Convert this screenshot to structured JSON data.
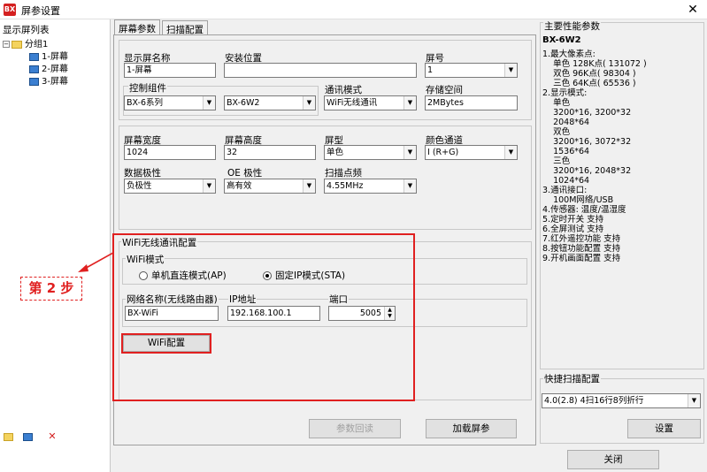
{
  "window": {
    "title": "屏参设置",
    "app_icon": "app-logo-icon",
    "close_glyph": "✕"
  },
  "sidebar": {
    "header": "显示屏列表",
    "group": "分组1",
    "items": [
      "1-屏幕",
      "2-屏幕",
      "3-屏幕"
    ]
  },
  "tabs": [
    "屏幕参数",
    "扫描配置"
  ],
  "screen": {
    "name_label": "显示屏名称",
    "name_value": "1-屏幕",
    "location_label": "安装位置",
    "location_value": "",
    "number_label": "屏号",
    "number_value": "1",
    "control_label": "控制组件",
    "series_value": "BX-6系列",
    "model_value": "BX-6W2",
    "comm_label": "通讯模式",
    "comm_value": "WiFi无线通讯",
    "storage_label": "存储空间",
    "storage_value": "2MBytes",
    "width_label": "屏幕宽度",
    "width_value": "1024",
    "height_label": "屏幕高度",
    "height_value": "32",
    "type_label": "屏型",
    "type_value": "单色",
    "color_label": "颜色通道",
    "color_value": "I (R+G)",
    "data_pol_label": "数据极性",
    "data_pol_value": "负极性",
    "oe_label": "OE 极性",
    "oe_value": "高有效",
    "scan_freq_label": "扫描点频",
    "scan_freq_value": "4.55MHz"
  },
  "wifi": {
    "section_label": "WiFi无线通讯配置",
    "mode_label": "WiFi模式",
    "mode_ap": "单机直连模式(AP)",
    "mode_sta": "固定IP模式(STA)",
    "selected_mode": "sta",
    "ssid_label": "网络名称(无线路由器)",
    "ssid_value": "BX-WiFi",
    "ip_label": "IP地址",
    "ip_value": "192.168.100.1",
    "port_label": "端口",
    "port_value": "5005",
    "config_button": "WiFi配置"
  },
  "buttons": {
    "readback": "参数回读",
    "load": "加载屏参",
    "settings": "设置",
    "close": "关闭"
  },
  "annotation": {
    "step": "第 2 步",
    "color": "#e02020"
  },
  "performance": {
    "title": "主要性能参数",
    "model": "BX-6W2",
    "text": "1.最大像素点:\n    单色 128K点( 131072 )\n    双色 96K点( 98304 )\n    三色 64K点( 65536 )\n2.显示模式:\n    单色\n    3200*16, 3200*32\n    2048*64\n    双色\n    3200*16, 3072*32\n    1536*64\n    三色\n    3200*16, 2048*32\n    1024*64\n3.通讯接口:\n    100M网络/USB\n4.传感器: 温度/温湿度\n5.定时开关 支持\n6.全屏测试 支持\n7.红外遥控功能 支持\n8.按钮功能配置 支持\n9.开机画面配置 支持"
  },
  "quick_scan": {
    "label": "快捷扫描配置",
    "value": "4.0(2.8)  4扫16行8列折行"
  }
}
